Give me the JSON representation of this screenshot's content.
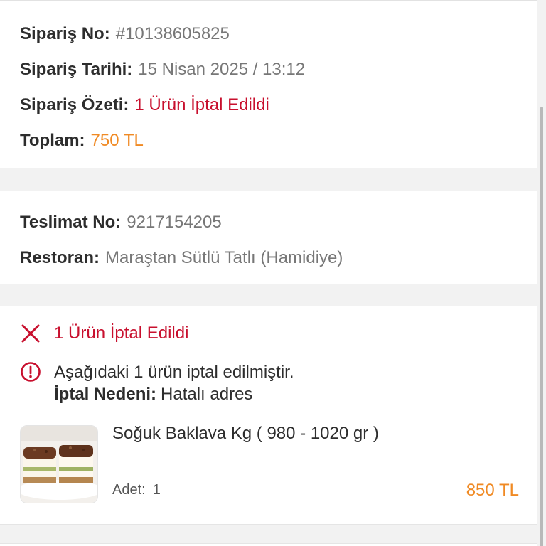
{
  "order": {
    "order_no_label": "Sipariş No:",
    "order_no": "#10138605825",
    "date_label": "Sipariş Tarihi:",
    "date": "15 Nisan 2025 / 13:12",
    "summary_label": "Sipariş Özeti:",
    "summary": "1 Ürün İptal Edildi",
    "total_label": "Toplam:",
    "total": "750 TL"
  },
  "delivery": {
    "delivery_no_label": "Teslimat No:",
    "delivery_no": "9217154205",
    "restaurant_label": "Restoran:",
    "restaurant": "Maraştan Sütlü Tatlı (Hamidiye)"
  },
  "cancellation": {
    "status": "1 Ürün İptal Edildi",
    "info_text": "Aşağıdaki 1 ürün iptal edilmiştir.",
    "reason_label": "İptal Nedeni:",
    "reason": "Hatalı adres"
  },
  "item": {
    "name": "Soğuk Baklava Kg ( 980 - 1020 gr )",
    "qty_label": "Adet:",
    "qty": "1",
    "price": "850 TL",
    "image_icon": "baklava-photo"
  },
  "colors": {
    "red": "#c8102e",
    "orange": "#f08a24",
    "label": "#2d2d2d",
    "value_gray": "#777777"
  }
}
